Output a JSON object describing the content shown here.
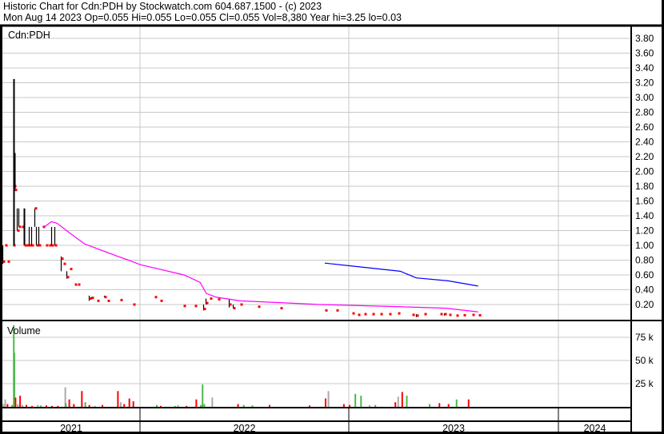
{
  "header": {
    "title": "Historic Chart for Cdn:PDH by Stockwatch.com 604.687.1500 - (c) 2023",
    "quote": "Mon Aug 14 2023  Op=0.055  Hi=0.055  Lo=0.055  Cl=0.055  Vol=8,380  Year hi=3.25  lo=0.03"
  },
  "colors": {
    "bar": "#000000",
    "close": "#ff0000",
    "ma_short": "#ff00ff",
    "ma_long": "#0000ff",
    "vol_up": "#4cb84c",
    "vol_down": "#ff0000",
    "vol_flat": "#aaaaaa",
    "grid": "#c8c8c8"
  },
  "chart_data": [
    {
      "type": "ohlc",
      "title": "Cdn:PDH",
      "x_unit": "days since 2021-01-01",
      "ylim": [
        0,
        3.9
      ],
      "yticks": [
        "3.80",
        "3.60",
        "3.40",
        "3.20",
        "3.00",
        "2.80",
        "2.60",
        "2.40",
        "2.20",
        "2.00",
        "1.80",
        "1.60",
        "1.40",
        "1.20",
        "1.00",
        "0.80",
        "0.60",
        "0.40",
        "0.20"
      ],
      "xlabels": [
        "2021",
        "2022",
        "2023",
        "2024"
      ],
      "bars": [
        [
          125,
          1.0,
          0.75,
          0.78
        ],
        [
          128,
          1.0,
          1.0,
          1.0
        ],
        [
          133,
          0.78,
          0.78,
          0.78
        ],
        [
          142,
          1.0,
          1.0,
          1.0
        ],
        [
          144,
          3.25,
          1.0,
          1.8
        ],
        [
          146,
          2.25,
          1.75,
          1.75
        ],
        [
          150,
          1.5,
          1.2,
          1.2
        ],
        [
          153,
          1.5,
          1.25,
          1.25
        ],
        [
          158,
          1.25,
          1.25,
          1.25
        ],
        [
          162,
          1.5,
          1.0,
          1.0
        ],
        [
          166,
          1.0,
          1.0,
          1.0
        ],
        [
          170,
          1.25,
          1.0,
          1.0
        ],
        [
          175,
          1.25,
          1.0,
          1.0
        ],
        [
          180,
          1.5,
          1.25,
          1.5
        ],
        [
          183,
          1.25,
          1.0,
          1.0
        ],
        [
          188,
          1.25,
          1.0,
          1.0
        ],
        [
          195,
          1.25,
          1.25,
          1.25
        ],
        [
          200,
          1.0,
          1.0,
          1.0
        ],
        [
          205,
          1.0,
          1.0,
          1.0
        ],
        [
          210,
          1.25,
          1.0,
          1.0
        ],
        [
          215,
          1.25,
          1.0,
          1.0
        ],
        [
          226,
          0.85,
          0.65,
          0.82
        ],
        [
          231,
          0.75,
          0.75,
          0.75
        ],
        [
          236,
          0.65,
          0.55,
          0.57
        ],
        [
          242,
          0.7,
          0.7,
          0.68
        ],
        [
          250,
          0.47,
          0.47,
          0.47
        ],
        [
          256,
          0.47,
          0.47,
          0.47
        ],
        [
          276,
          0.32,
          0.25,
          0.28
        ],
        [
          280,
          0.3,
          0.28,
          0.29
        ],
        [
          290,
          0.25,
          0.25,
          0.25
        ],
        [
          302,
          0.32,
          0.3,
          0.3
        ],
        [
          308,
          0.25,
          0.25,
          0.25
        ],
        [
          330,
          0.26,
          0.26,
          0.26
        ],
        [
          352,
          0.2,
          0.2,
          0.2
        ],
        [
          390,
          0.3,
          0.3,
          0.3
        ],
        [
          400,
          0.25,
          0.25,
          0.25
        ],
        [
          440,
          0.18,
          0.18,
          0.18
        ],
        [
          460,
          0.18,
          0.18,
          0.18
        ],
        [
          475,
          0.2,
          0.12,
          0.14
        ],
        [
          480,
          0.28,
          0.2,
          0.22
        ],
        [
          487,
          0.28,
          0.28,
          0.28
        ],
        [
          500,
          0.27,
          0.27,
          0.27
        ],
        [
          520,
          0.28,
          0.16,
          0.2
        ],
        [
          527,
          0.2,
          0.15,
          0.15
        ],
        [
          540,
          0.2,
          0.2,
          0.2
        ],
        [
          570,
          0.17,
          0.17,
          0.17
        ],
        [
          610,
          0.15,
          0.15,
          0.15
        ],
        [
          688,
          0.12,
          0.12,
          0.12
        ],
        [
          708,
          0.12,
          0.12,
          0.12
        ],
        [
          736,
          0.08,
          0.08,
          0.08
        ],
        [
          745,
          0.06,
          0.06,
          0.06
        ],
        [
          757,
          0.07,
          0.07,
          0.07
        ],
        [
          770,
          0.07,
          0.07,
          0.07
        ],
        [
          785,
          0.07,
          0.07,
          0.07
        ],
        [
          800,
          0.07,
          0.07,
          0.07
        ],
        [
          815,
          0.08,
          0.08,
          0.08
        ],
        [
          840,
          0.06,
          0.06,
          0.06
        ],
        [
          848,
          0.07,
          0.03,
          0.05
        ],
        [
          862,
          0.07,
          0.07,
          0.07
        ],
        [
          890,
          0.07,
          0.07,
          0.07
        ],
        [
          897,
          0.08,
          0.05,
          0.07
        ],
        [
          905,
          0.06,
          0.06,
          0.06
        ],
        [
          917,
          0.05,
          0.05,
          0.05
        ],
        [
          930,
          0.055,
          0.055,
          0.055
        ],
        [
          945,
          0.06,
          0.06,
          0.06
        ],
        [
          956,
          0.055,
          0.055,
          0.055
        ]
      ],
      "ma_short": [
        [
          198,
          1.25
        ],
        [
          210,
          1.32
        ],
        [
          220,
          1.3
        ],
        [
          240,
          1.18
        ],
        [
          268,
          1.02
        ],
        [
          323,
          0.86
        ],
        [
          345,
          0.8
        ],
        [
          365,
          0.74
        ],
        [
          442,
          0.6
        ],
        [
          470,
          0.5
        ],
        [
          481,
          0.35
        ],
        [
          498,
          0.3
        ],
        [
          540,
          0.25
        ],
        [
          680,
          0.2
        ],
        [
          820,
          0.17
        ],
        [
          900,
          0.15
        ],
        [
          956,
          0.1
        ]
      ],
      "ma_long": [
        [
          688,
          0.76
        ],
        [
          736,
          0.72
        ],
        [
          820,
          0.65
        ],
        [
          848,
          0.56
        ],
        [
          904,
          0.52
        ],
        [
          956,
          0.45
        ]
      ]
    },
    {
      "type": "bar",
      "title": "Volume",
      "yticks": [
        "75 k",
        "50 k",
        "25 k"
      ],
      "ylim": [
        0,
        105000
      ],
      "values": [
        [
          125,
          3000,
          "flat"
        ],
        [
          128,
          8000,
          "flat"
        ],
        [
          132,
          3000,
          "down"
        ],
        [
          140,
          2000,
          "up"
        ],
        [
          143,
          88000,
          "up"
        ],
        [
          144,
          58000,
          "up"
        ],
        [
          146,
          10000,
          "down"
        ],
        [
          150,
          3000,
          "flat"
        ],
        [
          154,
          12000,
          "down"
        ],
        [
          158,
          2000,
          "flat"
        ],
        [
          165,
          2000,
          "down"
        ],
        [
          175,
          1000,
          "down"
        ],
        [
          185,
          2000,
          "flat"
        ],
        [
          190,
          1500,
          "up"
        ],
        [
          200,
          1500,
          "down"
        ],
        [
          210,
          1000,
          "down"
        ],
        [
          220,
          1000,
          "down"
        ],
        [
          233,
          21000,
          "flat"
        ],
        [
          234,
          4000,
          "up"
        ],
        [
          240,
          8000,
          "down"
        ],
        [
          248,
          3000,
          "down"
        ],
        [
          262,
          17000,
          "down"
        ],
        [
          268,
          5000,
          "up"
        ],
        [
          275,
          2000,
          "down"
        ],
        [
          285,
          1000,
          "flat"
        ],
        [
          298,
          2000,
          "down"
        ],
        [
          325,
          17000,
          "down"
        ],
        [
          330,
          5000,
          "flat"
        ],
        [
          336,
          3000,
          "down"
        ],
        [
          345,
          9000,
          "down"
        ],
        [
          352,
          6000,
          "down"
        ],
        [
          393,
          2000,
          "up"
        ],
        [
          400,
          1000,
          "down"
        ],
        [
          425,
          1000,
          "up"
        ],
        [
          430,
          2000,
          "flat"
        ],
        [
          445,
          1000,
          "down"
        ],
        [
          462,
          8000,
          "down"
        ],
        [
          470,
          2000,
          "up"
        ],
        [
          473,
          24000,
          "up"
        ],
        [
          476,
          3000,
          "up"
        ],
        [
          490,
          10000,
          "flat"
        ],
        [
          535,
          3000,
          "down"
        ],
        [
          545,
          2000,
          "up"
        ],
        [
          560,
          1500,
          "up"
        ],
        [
          590,
          2000,
          "down"
        ],
        [
          660,
          1500,
          "down"
        ],
        [
          688,
          9000,
          "down"
        ],
        [
          693,
          17000,
          "flat"
        ],
        [
          720,
          3000,
          "down"
        ],
        [
          730,
          2000,
          "down"
        ],
        [
          740,
          14000,
          "up"
        ],
        [
          750,
          12000,
          "up"
        ],
        [
          765,
          2000,
          "flat"
        ],
        [
          775,
          2000,
          "up"
        ],
        [
          810,
          5000,
          "down"
        ],
        [
          815,
          11000,
          "flat"
        ],
        [
          822,
          16000,
          "down"
        ],
        [
          830,
          12000,
          "up"
        ],
        [
          870,
          3000,
          "up"
        ],
        [
          887,
          4000,
          "down"
        ],
        [
          903,
          3000,
          "down"
        ],
        [
          917,
          8000,
          "up"
        ],
        [
          938,
          8000,
          "down"
        ]
      ]
    }
  ]
}
